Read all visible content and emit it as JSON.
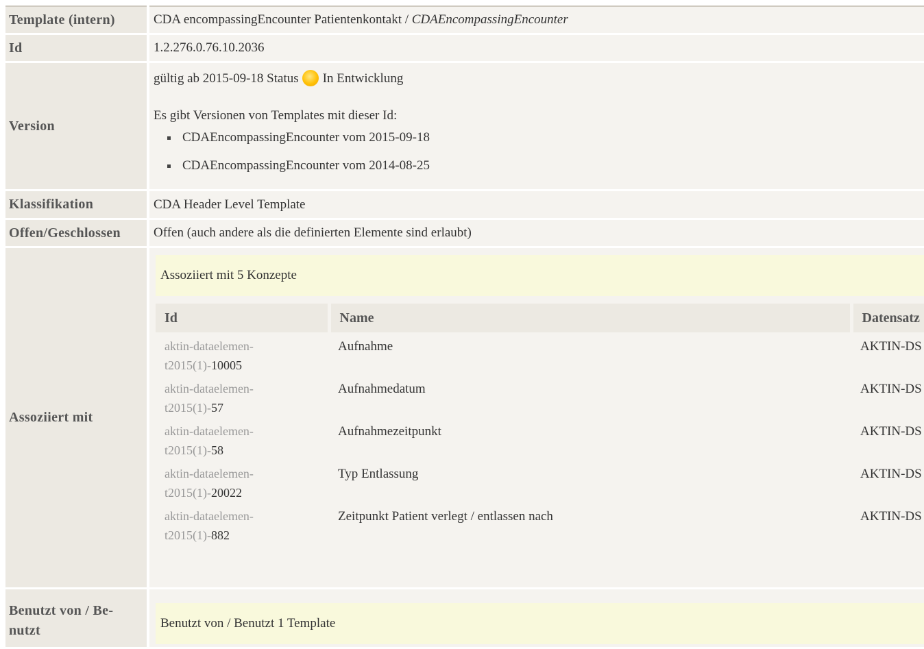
{
  "template": {
    "label": "Template (intern)",
    "name": "CDA encompassingEncounter Patientenkontakt",
    "separator": " / ",
    "internal_name": "CDAEncompassingEncounter"
  },
  "id": {
    "label": "Id",
    "value": "1.2.276.0.76.10.2036"
  },
  "version": {
    "label": "Version",
    "valid_prefix": "gültig ab 2015-09-18 Status",
    "status_icon": "status-yellow-dot-icon",
    "status_text": "In Entwicklung",
    "versions_intro": "Es gibt Versionen von Templates mit dieser Id:",
    "versions": [
      "CDAEncompassingEncounter vom 2015-09-18",
      "CDAEncompassingEncounter vom 2014-08-25"
    ]
  },
  "classification": {
    "label": "Klassifikation",
    "value": "CDA Header Level Template"
  },
  "openclosed": {
    "label": "Offen/Geschlossen",
    "value": "Offen (auch andere als die definierten Elemente sind erlaubt)"
  },
  "associated": {
    "label": "Assoziiert mit",
    "box_text": "Assoziiert mit 5 Konzepte",
    "headers": {
      "id": "Id",
      "name": "Name",
      "dataset": "Datensatz"
    },
    "rows": [
      {
        "id_line1": "aktin-dataelemen-",
        "id_prefix": "t2015(1)-",
        "id_num": "10005",
        "name": "Aufnahme",
        "dataset": "AKTIN-DS"
      },
      {
        "id_line1": "aktin-dataelemen-",
        "id_prefix": "t2015(1)-",
        "id_num": "57",
        "name": "Aufnahmedatum",
        "dataset": "AKTIN-DS"
      },
      {
        "id_line1": "aktin-dataelemen-",
        "id_prefix": "t2015(1)-",
        "id_num": "58",
        "name": "Aufnahmezeitpunkt",
        "dataset": "AKTIN-DS"
      },
      {
        "id_line1": "aktin-dataelemen-",
        "id_prefix": "t2015(1)-",
        "id_num": "20022",
        "name": "Typ Entlassung",
        "dataset": "AKTIN-DS"
      },
      {
        "id_line1": "aktin-dataelemen-",
        "id_prefix": "t2015(1)-",
        "id_num": "882",
        "name": "Zeitpunkt Patient verlegt / entlassen nach",
        "dataset": "AKTIN-DS"
      }
    ]
  },
  "usedby": {
    "label_line1": "Benutzt von / Be-",
    "label_line2": "nutzt",
    "box_text": "Benutzt von / Benutzt 1 Template"
  }
}
